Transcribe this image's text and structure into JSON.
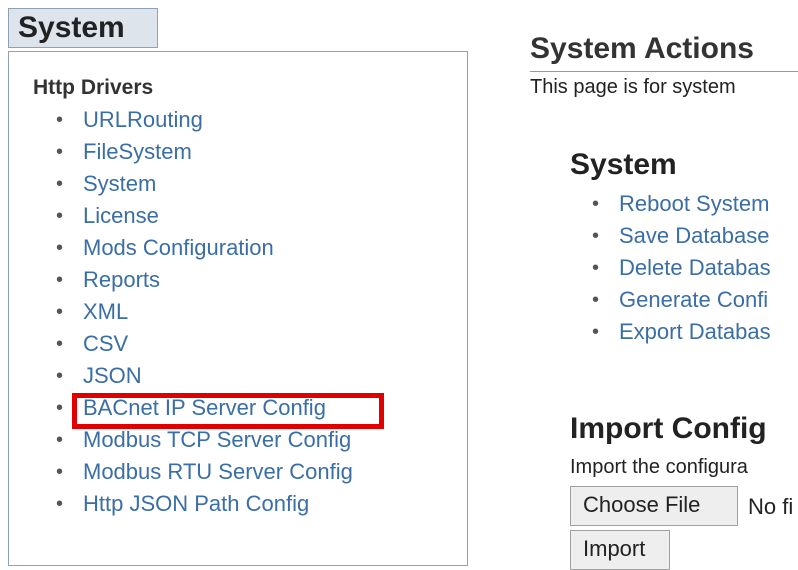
{
  "system_tab": {
    "label": "System"
  },
  "drivers": {
    "heading": "Http Drivers",
    "items": [
      "URLRouting",
      "FileSystem",
      "System",
      "License",
      "Mods Configuration",
      "Reports",
      "XML",
      "CSV",
      "JSON",
      "BACnet IP Server Config",
      "Modbus TCP Server Config",
      "Modbus RTU Server Config",
      "Http JSON Path Config"
    ],
    "highlighted_item": "BACnet IP Server Config",
    "highlight_color": "#e00000"
  },
  "actions": {
    "title": "System Actions",
    "description": "This page is for system",
    "system_heading": "System",
    "items": [
      "Reboot System",
      "Save Database",
      "Delete Databas",
      "Generate Confi",
      "Export Databas"
    ]
  },
  "import_config": {
    "title": "Import Config",
    "description": "Import the configura",
    "choose_file_label": "Choose File",
    "no_file_text": "No fi",
    "import_label": "Import"
  },
  "colors": {
    "link": "#3a6ea5",
    "tab_bg": "#dde4ec",
    "border": "#8ea2b6"
  }
}
